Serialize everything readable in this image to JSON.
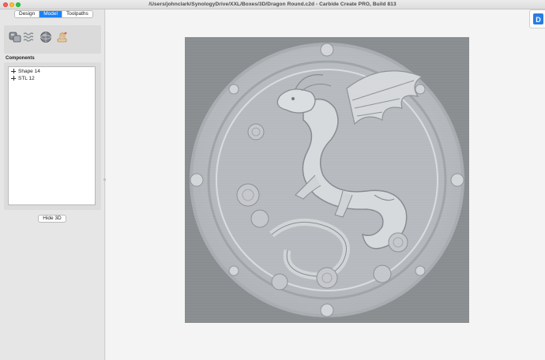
{
  "window": {
    "title": "/Users/johnclark/SynologyDrive/XXL/Boxes/3D/Dragon Round.c2d - Carbide Create PRO, Build 813"
  },
  "tabs": [
    {
      "label": "Design",
      "active": false
    },
    {
      "label": "Model",
      "active": true
    },
    {
      "label": "Toolpaths",
      "active": false
    }
  ],
  "toolbar": {
    "tools": [
      "component-shape-icon",
      "texture-pattern-icon",
      "sphere-icon",
      "hand-paint-icon"
    ]
  },
  "components": {
    "label": "Components",
    "items": [
      {
        "label": "Shape 14"
      },
      {
        "label": "STL 12"
      }
    ]
  },
  "hide_button": {
    "label": "Hide 3D"
  },
  "colors": {
    "accent": "#1b82f5",
    "relief_background": "#888b8e",
    "relief_surface": "#c8cbcd"
  }
}
